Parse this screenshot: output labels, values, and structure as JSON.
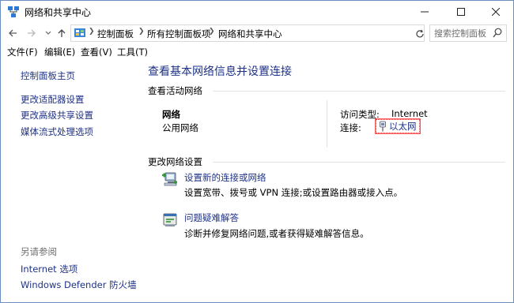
{
  "window": {
    "title": "网络和共享中心"
  },
  "nav": {
    "breadcrumbs": [
      "控制面板",
      "所有控制面板项",
      "网络和共享中心"
    ],
    "search_placeholder": "搜索控制面板"
  },
  "menubar": {
    "items": [
      "文件(F)",
      "编辑(E)",
      "查看(V)",
      "工具(T)"
    ]
  },
  "left_pane": {
    "home": "控制面板主页",
    "links": [
      "更改适配器设置",
      "更改高级共享设置",
      "媒体流式处理选项"
    ],
    "see_also_label": "另请参阅",
    "see_also_links": [
      "Internet 选项",
      "Windows Defender 防火墙"
    ]
  },
  "main": {
    "title": "查看基本网络信息并设置连接",
    "active_networks": {
      "heading": "查看活动网络",
      "network_name": "网络",
      "network_type": "公用网络",
      "access_type_label": "访问类型:",
      "access_type_value": "Internet",
      "connections_label": "连接:",
      "connection_name": "以太网"
    },
    "change_settings": {
      "heading": "更改网络设置",
      "tasks": [
        {
          "title": "设置新的连接或网络",
          "description": "设置宽带、拨号或 VPN 连接;或设置路由器或接入点。",
          "icon": "new-connection-icon"
        },
        {
          "title": "问题疑难解答",
          "description": "诊断并修复网络问题,或者获得疑难解答信息。",
          "icon": "troubleshoot-icon"
        }
      ]
    }
  },
  "colors": {
    "link": "#1e3287",
    "focus_outline": "#ff5a5a"
  }
}
